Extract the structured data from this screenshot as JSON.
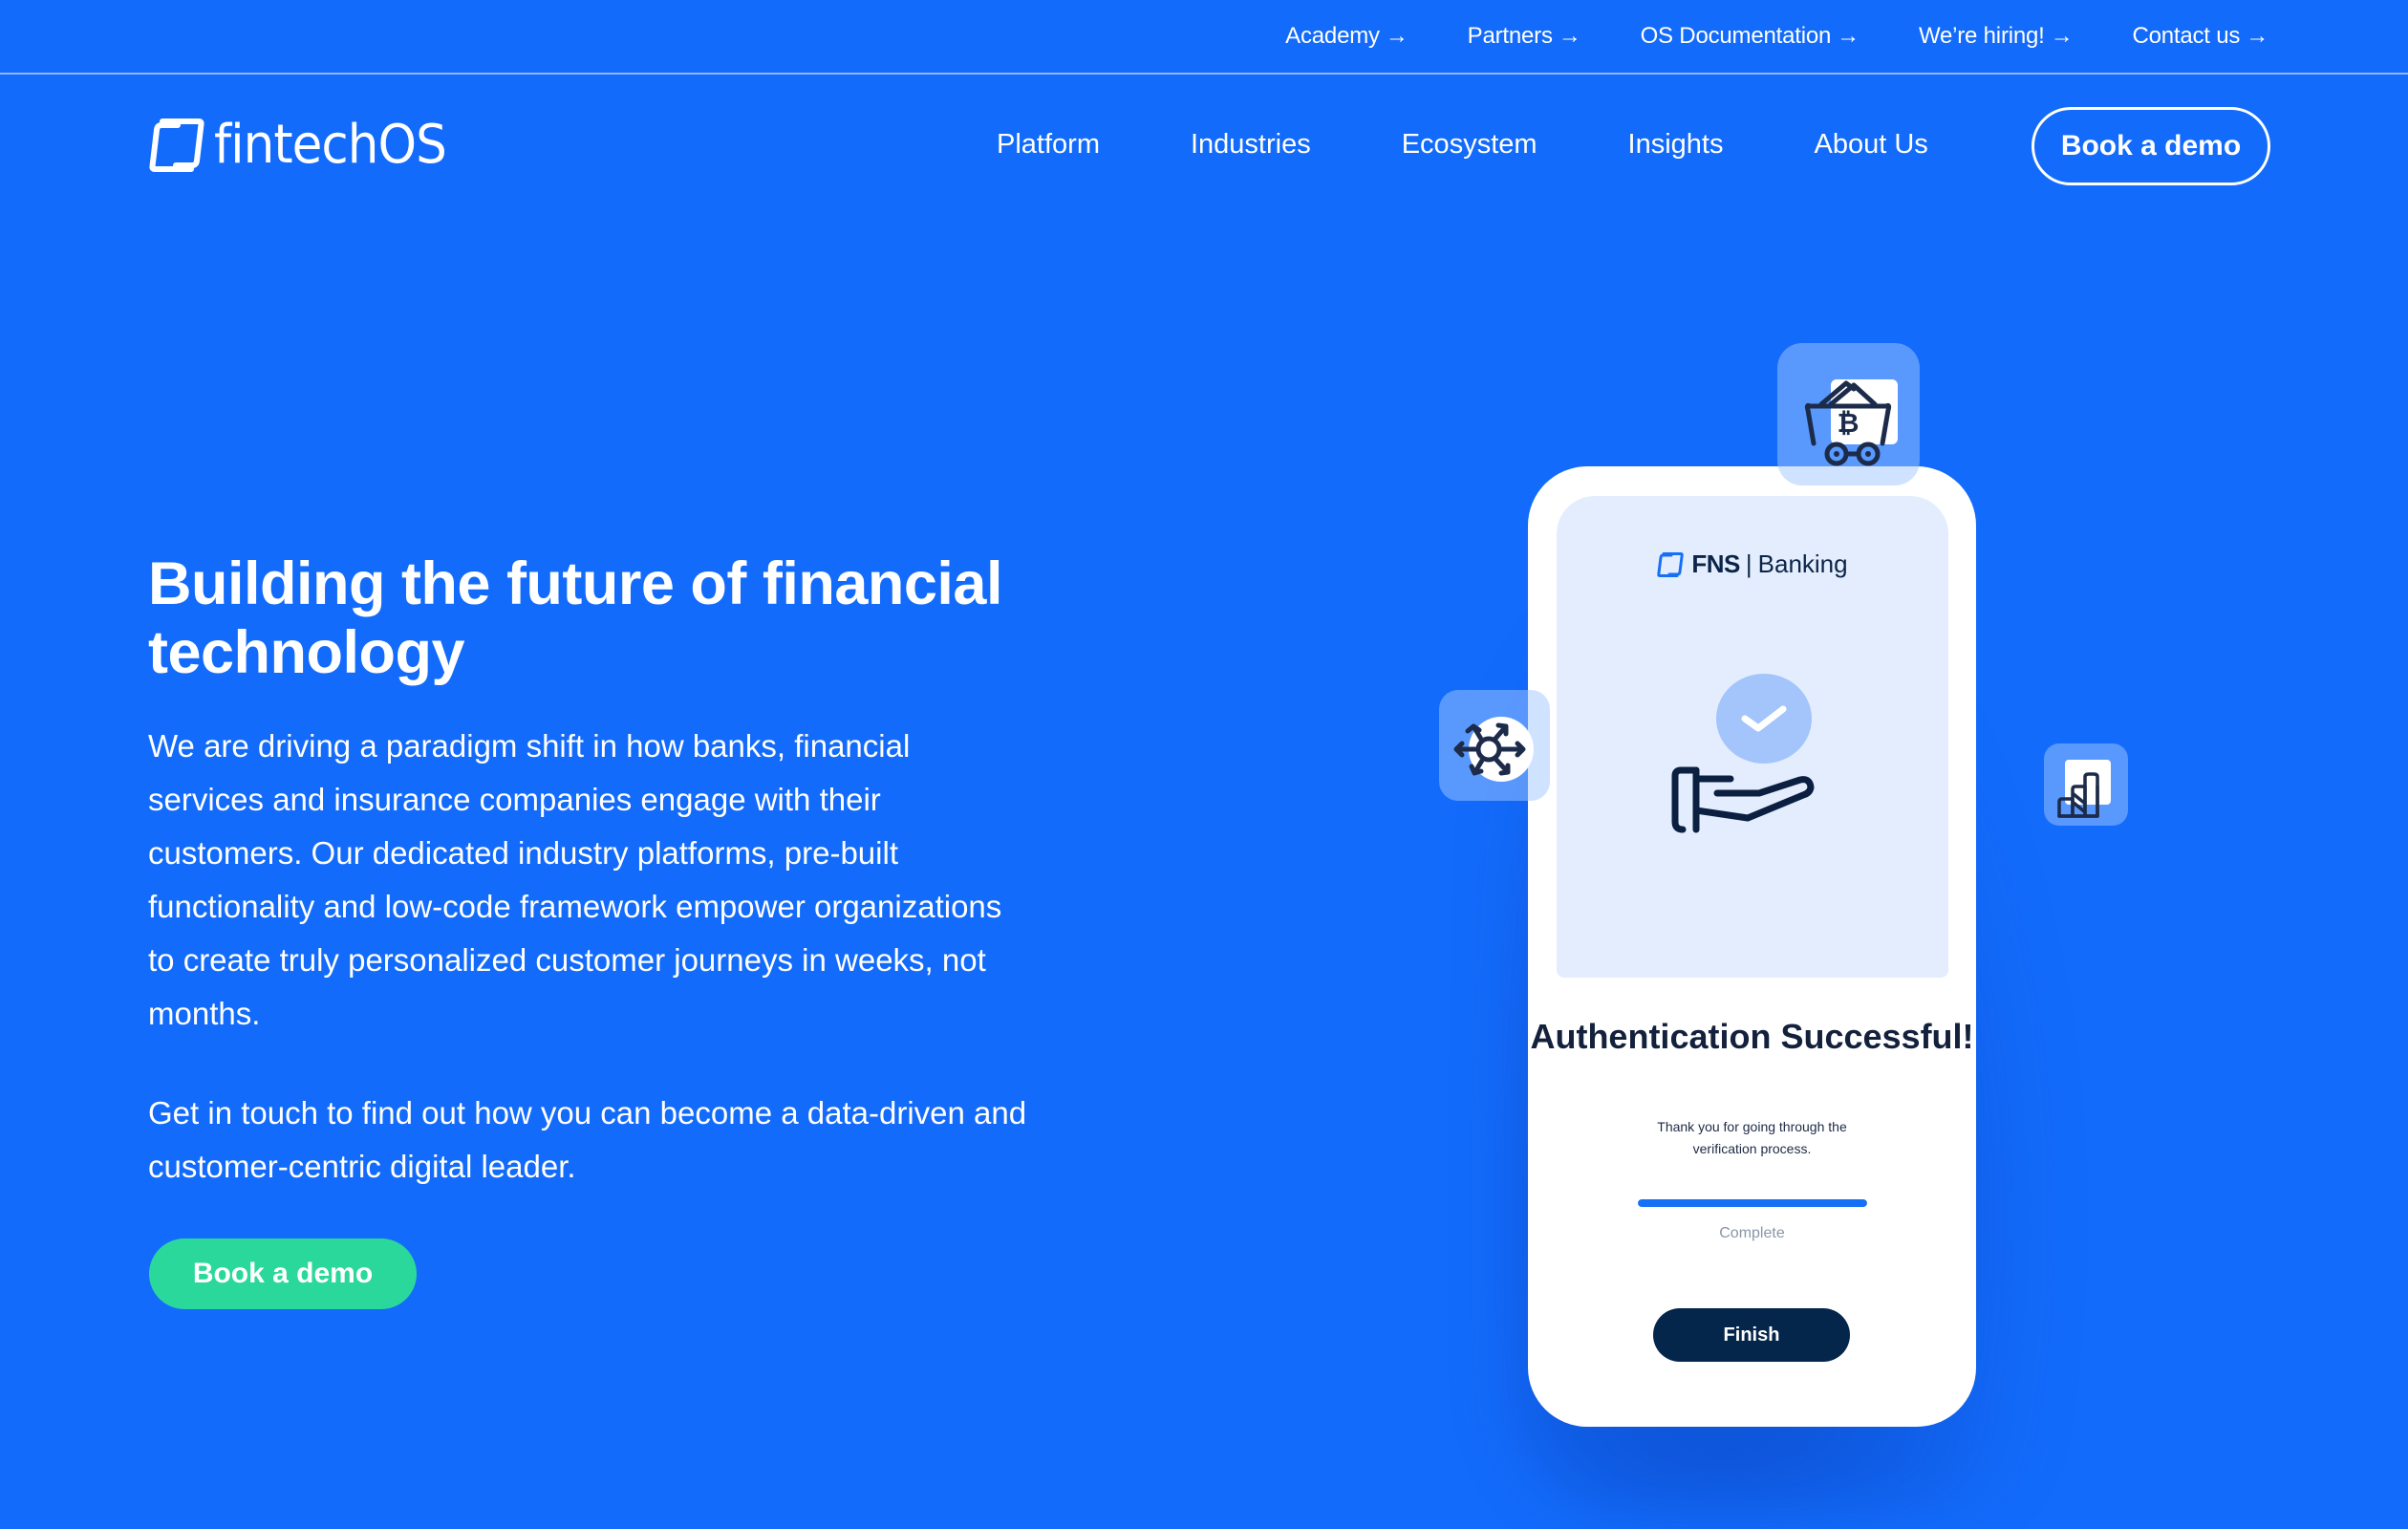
{
  "topbar": {
    "links": [
      {
        "label": "Academy",
        "icon": "arrow-right-icon",
        "glyph": "→"
      },
      {
        "label": "Partners",
        "icon": "arrow-right-icon",
        "glyph": "→"
      },
      {
        "label": "OS Documentation",
        "icon": "arrow-right-icon",
        "glyph": "→"
      },
      {
        "label": "We’re hiring!",
        "icon": "arrow-right-icon",
        "glyph": "→"
      },
      {
        "label": "Contact us",
        "icon": "arrow-right-icon",
        "glyph": "→"
      }
    ]
  },
  "header": {
    "logo_text": "fintechOS",
    "nav": [
      {
        "label": "Platform"
      },
      {
        "label": "Industries"
      },
      {
        "label": "Ecosystem"
      },
      {
        "label": "Insights"
      },
      {
        "label": "About Us"
      }
    ],
    "cta_label": "Book a demo"
  },
  "hero": {
    "title": "Building the future of financial technology",
    "paragraph_1": "We are driving a paradigm shift in how banks, financial services and insurance companies engage with their customers. Our dedicated industry platforms, pre-built functionality and low-code framework empower organizations to create truly personalized customer journeys in weeks, not months.",
    "paragraph_2": "Get in touch to find out how you can become a data-driven and customer-centric digital leader.",
    "cta_label": "Book a demo"
  },
  "phone": {
    "brand_bold": "FNS",
    "brand_separator": "|",
    "brand_light": "Banking",
    "status_icon": "check-circle-icon",
    "illustration": "hand-receiving-icon",
    "title": "Authentication Successful!",
    "subtitle": "Thank you for going through the verification process.",
    "progress": 1.0,
    "progress_label": "Complete",
    "finish_label": "Finish"
  },
  "floating_icons": [
    {
      "name": "bitcoin-mining-cart-icon"
    },
    {
      "name": "network-distribution-icon"
    },
    {
      "name": "bar-chart-growth-icon"
    }
  ],
  "colors": {
    "background": "#136BFB",
    "cta_green": "#2BD89B",
    "navy": "#04264A",
    "screen_tint": "#E3EDFD",
    "progress": "#1570F5"
  }
}
